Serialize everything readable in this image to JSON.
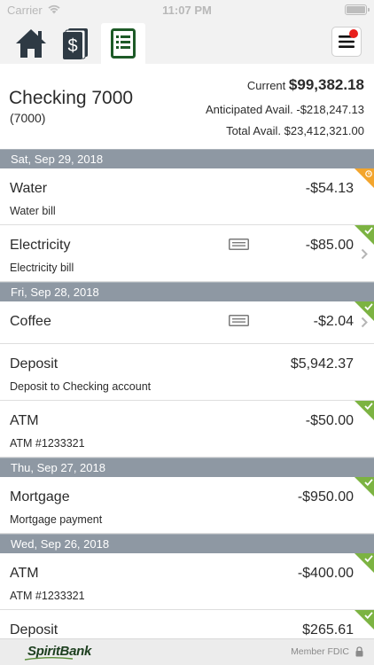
{
  "status_bar": {
    "carrier": "Carrier",
    "time": "11:07 PM"
  },
  "nav": {
    "tabs": [
      {
        "icon": "home-icon",
        "active": false
      },
      {
        "icon": "money-icon",
        "active": false
      },
      {
        "icon": "statement-icon",
        "active": true
      }
    ],
    "menu_icon": "hamburger-menu-icon",
    "menu_has_notification": true
  },
  "account": {
    "name": "Checking 7000",
    "number": "(7000)",
    "current_label": "Current",
    "current_amount": "$99,382.18",
    "anticipated_label": "Anticipated Avail.",
    "anticipated_amount": "-$218,247.13",
    "total_label": "Total Avail.",
    "total_amount": "$23,412,321.00"
  },
  "groups": [
    {
      "date": "Sat, Sep 29, 2018",
      "transactions": [
        {
          "title": "Water",
          "description": "Water bill",
          "amount": "-$54.13",
          "status": "pending",
          "has_receipt": false,
          "has_chevron": false
        },
        {
          "title": "Electricity",
          "description": "Electricity bill",
          "amount": "-$85.00",
          "status": "cleared",
          "has_receipt": true,
          "has_chevron": true
        }
      ]
    },
    {
      "date": "Fri, Sep 28, 2018",
      "transactions": [
        {
          "title": "Coffee",
          "description": "",
          "amount": "-$2.04",
          "status": "cleared",
          "has_receipt": true,
          "has_chevron": true
        },
        {
          "title": "Deposit",
          "description": "Deposit to Checking account",
          "amount": "$5,942.37",
          "status": "none",
          "has_receipt": false,
          "has_chevron": false
        },
        {
          "title": "ATM",
          "description": "ATM #1233321",
          "amount": "-$50.00",
          "status": "cleared",
          "has_receipt": false,
          "has_chevron": false
        }
      ]
    },
    {
      "date": "Thu, Sep 27, 2018",
      "transactions": [
        {
          "title": "Mortgage",
          "description": "Mortgage payment",
          "amount": "-$950.00",
          "status": "cleared",
          "has_receipt": false,
          "has_chevron": false
        }
      ]
    },
    {
      "date": "Wed, Sep 26, 2018",
      "transactions": [
        {
          "title": "ATM",
          "description": "ATM #1233321",
          "amount": "-$400.00",
          "status": "cleared",
          "has_receipt": false,
          "has_chevron": false
        },
        {
          "title": "Deposit",
          "description": "",
          "amount": "$265.61",
          "status": "cleared",
          "has_receipt": false,
          "has_chevron": false
        }
      ]
    }
  ],
  "footer": {
    "logo_text": "SpiritBank",
    "member_text": "Member FDIC"
  },
  "colors": {
    "date_header_bg": "#8e98a3",
    "cleared_green": "#7cb342",
    "pending_orange": "#f3a52d",
    "notification_red": "#e8201c",
    "brand_green": "#1d5a27"
  }
}
